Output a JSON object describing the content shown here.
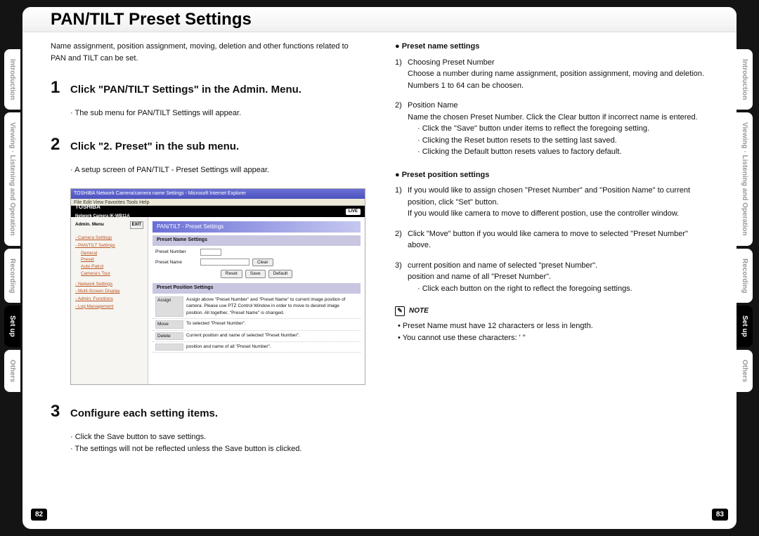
{
  "title": "PAN/TILT Preset Settings",
  "intro": "Name assignment, position assignment, moving, deletion and other functions related to PAN and TILT can be set.",
  "tabs": {
    "t1": "Introduction",
    "t2": "Viewing · Listening and Operation",
    "t3": "Recording",
    "t4": "Set up",
    "t5": "Others"
  },
  "steps": {
    "s1": {
      "num": "1",
      "text": "Click \"PAN/TILT Settings\" in the Admin. Menu.",
      "body": "The sub menu for PAN/TILT Settings will appear."
    },
    "s2": {
      "num": "2",
      "text": "Click \"2. Preset\" in the sub menu.",
      "body": "A setup screen of PAN/TILT - Preset Settings will appear."
    },
    "s3": {
      "num": "3",
      "text": "Configure each setting items.",
      "body1": "Click the Save button to save settings.",
      "body2": "The settings will not be reflected unless the Save button is clicked."
    }
  },
  "screenshot": {
    "browser_title": "TOSHIBA Network Camera/camera name  Settings - Microsoft Internet Explorer",
    "menu": "File  Edit  View  Favorites  Tools  Help",
    "brand": "TOSHIBA",
    "model": "Network Camera  IK-WB11A",
    "live": "LIVE",
    "admin_hdr": "Admin. Menu",
    "exit": "EXIT",
    "m1": "- Camera Settings",
    "m2": "- PAN/TILT Settings",
    "m2a": "General",
    "m2b": "Preset",
    "m2c": "Auto Patrol",
    "m2d": "Camera's Tour",
    "m3": "- Network Settings",
    "m4": "- Multi-Screen Display",
    "m5": "- Admin. Functions",
    "m6": "- Log Management",
    "section_hdr": "PAN/TILT - Preset Settings",
    "sub1": "Preset Name Settings",
    "lbl_num": "Preset Number",
    "lbl_name": "Preset Name",
    "btn_clear": "Clear",
    "btn_reset": "Reset",
    "btn_save": "Save",
    "btn_default": "Default",
    "sub2": "Preset Position Settings",
    "r1l": "Assign",
    "r1d": "Assign above \"Preset Number\" and \"Preset Name\" to current image position of camera. Please use PTZ Control Window in order to move to desired image position. All together, \"Preset Name\" is changed.",
    "r2l": "Move",
    "r2d": "To selected \"Preset Number\".",
    "r3l": "Delete",
    "r3d": "Current position and name of selected \"Preset Number\".",
    "r4d": "position and name of all \"Preset Number\"."
  },
  "right": {
    "h1": "Preset name settings",
    "i1n": "1)",
    "i1t": "Choosing Preset Number",
    "i1a": "Choose a number during name assignment, position assignment, moving and deletion.",
    "i1b": "Numbers 1 to 64 can be choosen.",
    "i2n": "2)",
    "i2t": "Position Name",
    "i2a": "Name the chosen Preset Number.  Click the Clear button if incorrect name is entered.",
    "i2b": "Click the \"Save\" button under items to reflect the foregoing setting.",
    "i2c": "Clicking the Reset button resets to the setting last saved.",
    "i2d": "Clicking the Default button resets values to factory default.",
    "h2": "Preset position settings",
    "p1n": "1)",
    "p1t": "If you would like to assign chosen \"Preset Number\" and \"Position Name\" to current position, click \"Set\" button.",
    "p1a": "If you would like camera to move to different postion, use the controller window.",
    "p2n": "2)",
    "p2t": "Click \"Move\" button if you would like camera to move to selected \"Preset Number\" above.",
    "p3n": "3)",
    "p3t": "current position and name of selected \"preset Number\".",
    "p3a": "position and name of all \"Preset Number\".",
    "p3b": "Click each button on the right to reflect the foregoing settings.",
    "note": "NOTE",
    "n1": "Preset Name must have 12 characters or less in length.",
    "n2": "You cannot use these characters: ' \""
  },
  "page_left": "82",
  "page_right": "83"
}
